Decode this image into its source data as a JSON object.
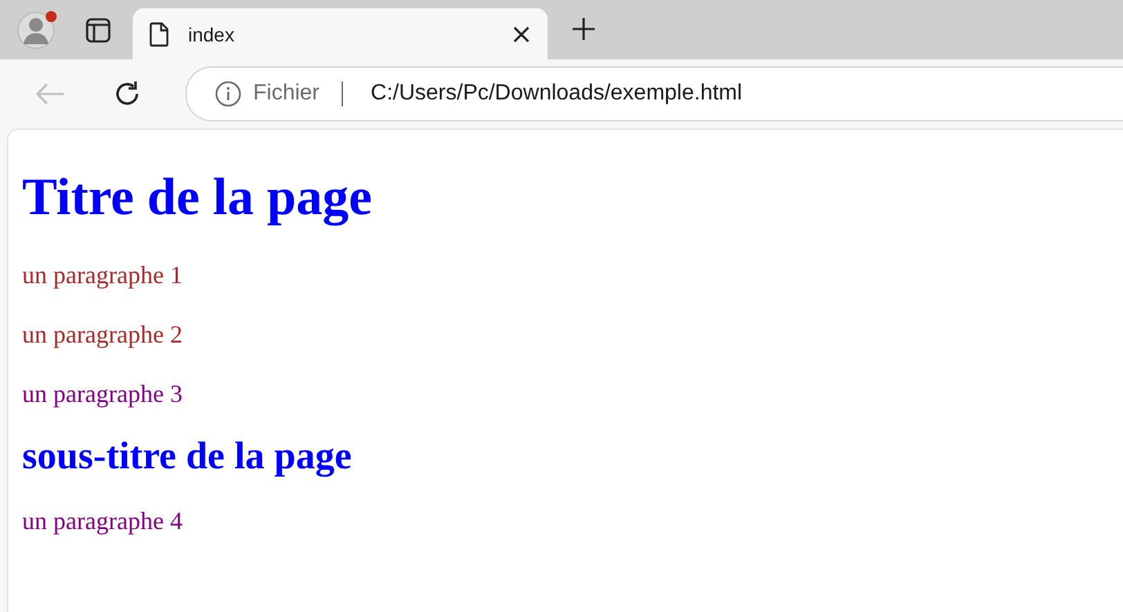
{
  "tabs": [
    {
      "title": "index",
      "selected": true
    }
  ],
  "address_bar": {
    "scheme_label": "Fichier",
    "url": "C:/Users/Pc/Downloads/exemple.html"
  },
  "profile": {
    "notification": true
  },
  "content": [
    {
      "kind": "title",
      "text": "Titre de la page",
      "color": "#0000ff"
    },
    {
      "kind": "paragraph",
      "text": "un paragraphe 1",
      "color": "#a52a2a"
    },
    {
      "kind": "paragraph",
      "text": "un paragraphe 2",
      "color": "#a52a2a"
    },
    {
      "kind": "paragraph",
      "text": "un paragraphe 3",
      "color": "#800080"
    },
    {
      "kind": "subtitle",
      "text": "sous-titre de la page",
      "color": "#0000ff"
    },
    {
      "kind": "paragraph",
      "text": "un paragraphe 4",
      "color": "#800080"
    }
  ]
}
